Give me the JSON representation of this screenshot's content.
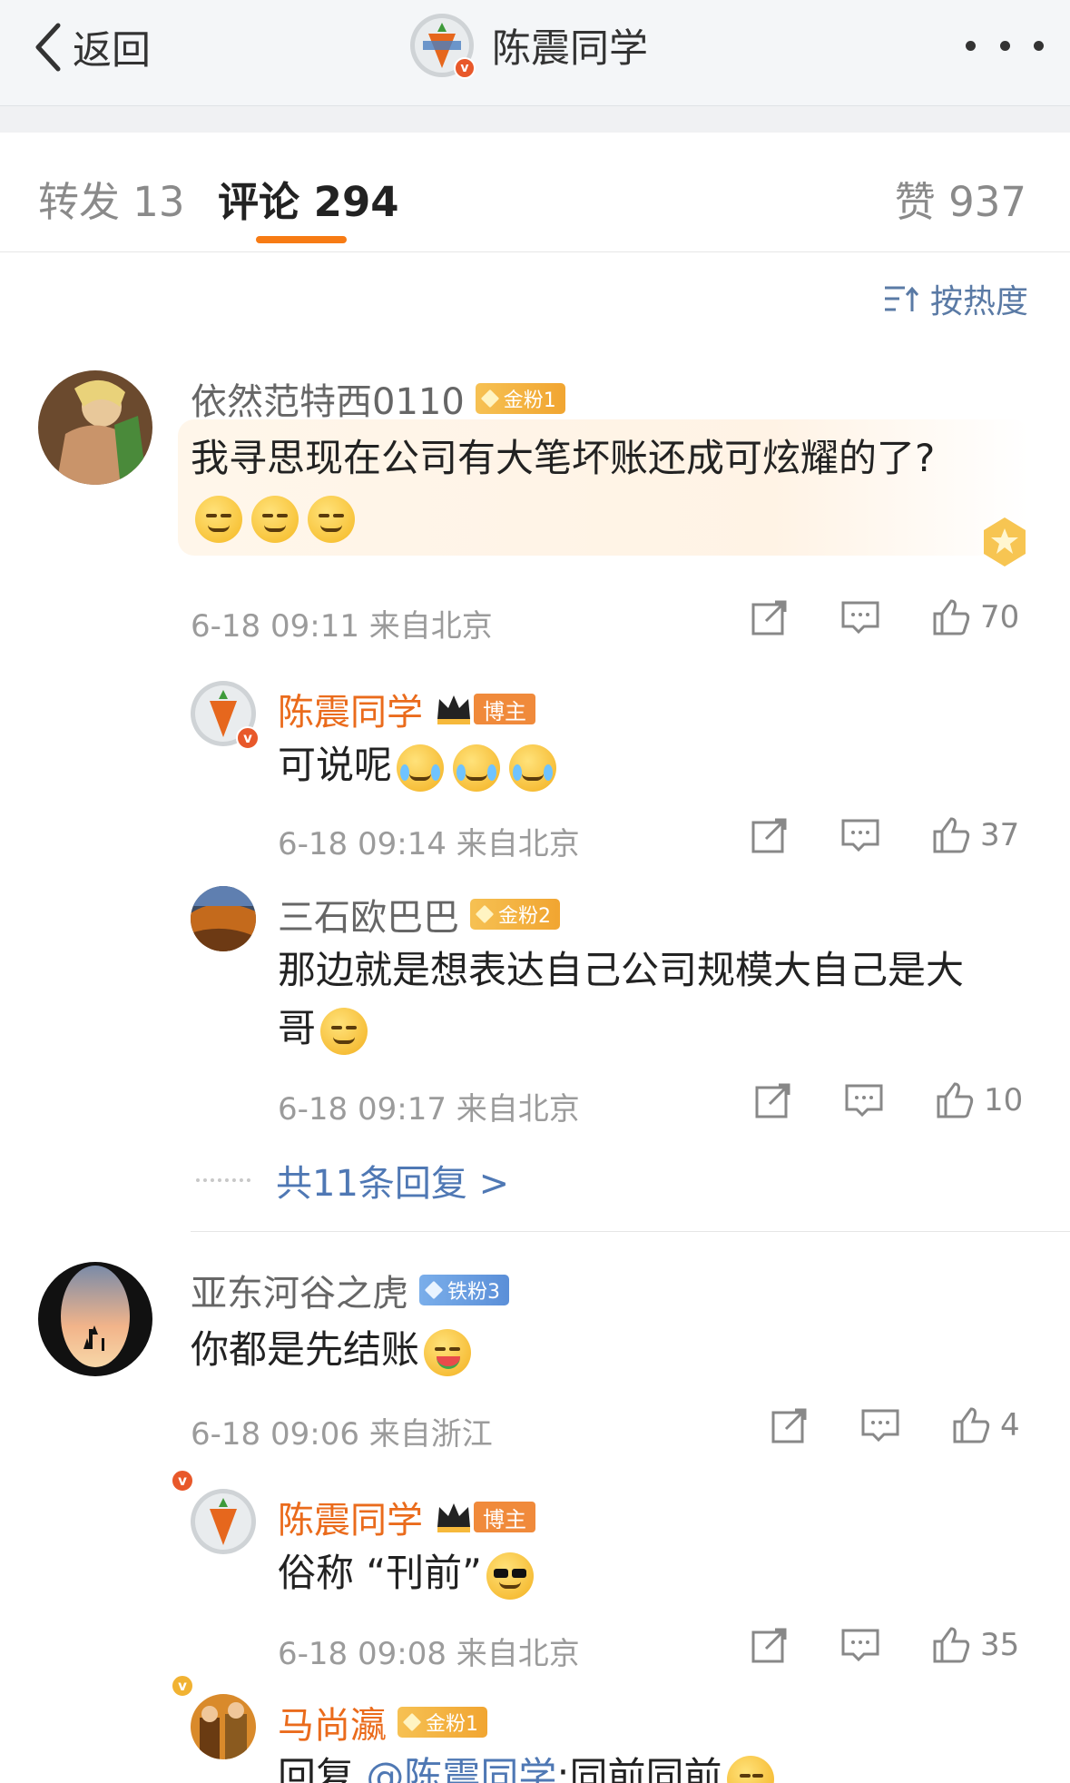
{
  "nav": {
    "back_label": "返回",
    "title": "陈震同学"
  },
  "tabs": {
    "repost_label": "转发 13",
    "comment_label": "评论 294",
    "like_label": "赞 937"
  },
  "sort": {
    "label": "按热度"
  },
  "comments": [
    {
      "user": "依然范特西0110",
      "badge": "金粉1",
      "text": "我寻思现在公司有大笔坏账还成可炫耀的了?",
      "time": "6-18 09:11",
      "location": "来自北京",
      "likes": "70",
      "replies": [
        {
          "user": "陈震同学",
          "badge": "博主",
          "text": "可说呢",
          "time": "6-18 09:14",
          "location": "来自北京",
          "likes": "37"
        },
        {
          "user": "三石欧巴巴",
          "badge": "金粉2",
          "text_line1": "那边就是想表达自己公司规模大自己是大",
          "text_line2": "哥",
          "time": "6-18 09:17",
          "location": "来自北京",
          "likes": "10"
        }
      ],
      "more_replies": "共11条回复 >"
    },
    {
      "user": "亚东河谷之虎",
      "badge": "铁粉3",
      "text": "你都是先结账",
      "time": "6-18 09:06",
      "location": "来自浙江",
      "likes": "4",
      "replies": [
        {
          "user": "陈震同学",
          "badge": "博主",
          "text": "俗称 “刊前”",
          "time": "6-18 09:08",
          "location": "来自北京",
          "likes": "35"
        },
        {
          "user": "马尚瀛",
          "badge": "金粉1",
          "text_prefix": "回复 ",
          "mention": "@陈震同学",
          "text_suffix": ":同前同前"
        }
      ]
    }
  ],
  "icons": {
    "back": "chevron-left-icon",
    "more": "more-dots-icon",
    "sort": "sort-icon",
    "repost": "repost-icon",
    "comment": "comment-icon",
    "like": "thumbs-up-icon"
  },
  "colors": {
    "accent": "#f77b14",
    "link": "#4f78b4",
    "author": "#ea6b1c",
    "gold_badge": "#f1a531",
    "iron_badge": "#5b8fd8"
  }
}
